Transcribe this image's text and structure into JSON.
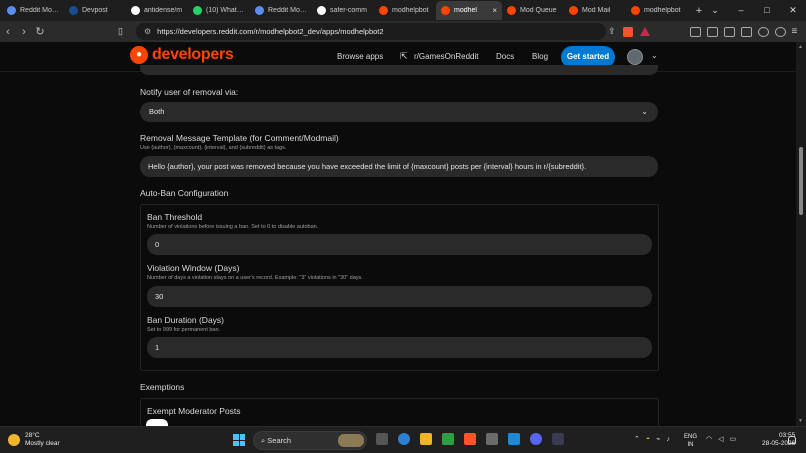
{
  "browser": {
    "tabs": [
      {
        "label": "Reddit Mod T",
        "color": "#5b8def",
        "active": false
      },
      {
        "label": "Devpost",
        "color": "#1a4d8f",
        "active": false
      },
      {
        "label": "antidense/m",
        "color": "#ffffff",
        "active": false
      },
      {
        "label": "(10) WhatsAp",
        "color": "#25d366",
        "active": false
      },
      {
        "label": "Reddit Mod T",
        "color": "#5b8def",
        "active": false
      },
      {
        "label": "safer-comm",
        "color": "#ffffff",
        "active": false
      },
      {
        "label": "modhelpbot",
        "color": "#ff4500",
        "active": false
      },
      {
        "label": "modhel",
        "color": "#ff4500",
        "active": true
      },
      {
        "label": "Mod Queue",
        "color": "#ff4500",
        "active": false
      },
      {
        "label": "Mod Mail",
        "color": "#ff4500",
        "active": false
      },
      {
        "label": "modhelpbot",
        "color": "#ff4500",
        "active": false
      }
    ],
    "new_tab": "+",
    "tab_close": "×",
    "window_controls": [
      "⌄",
      "–",
      "□",
      "✕"
    ],
    "url": "https://developers.reddit.com/r/modhelpbot2_dev/apps/modhelpbot2",
    "brave_count": "8"
  },
  "site": {
    "logo_text": "developers",
    "nav": {
      "browse": "Browse apps",
      "subreddit": "r/GamesOnReddit",
      "docs": "Docs",
      "blog": "Blog",
      "cta": "Get started"
    }
  },
  "form": {
    "notify_label": "Notify user of removal via:",
    "notify_value": "Both",
    "template_label": "Removal Message Template (for Comment/Modmail)",
    "template_help": "Use {author}, {maxcount}, {interval}, and {subreddit} as tags.",
    "template_value": "Hello {author}, your post was removed because you have exceeded the limit of {maxcount} posts per {interval} hours in r/{subreddit}.",
    "autoban_title": "Auto-Ban Configuration",
    "ban_threshold_label": "Ban Threshold",
    "ban_threshold_help": "Number of violations before issuing a ban. Set to 0 to disable autoban.",
    "ban_threshold_value": "0",
    "violation_window_label": "Violation Window (Days)",
    "violation_window_help": "Number of days a violation stays on a user's record. Example: \"3\" violations in \"30\" days.",
    "violation_window_value": "30",
    "ban_duration_label": "Ban Duration (Days)",
    "ban_duration_help": "Set to 999 for permanent ban.",
    "ban_duration_value": "1",
    "exemptions_title": "Exemptions",
    "exempt_mod_label": "Exempt Moderator Posts"
  },
  "taskbar": {
    "temp": "28°C",
    "weather": "Mostly clear",
    "search": "Search",
    "lang1": "ENG",
    "lang2": "IN",
    "time": "03:55",
    "date": "28-05-2026"
  },
  "colors": {
    "accent": "#ff4500",
    "cta": "#0079d3"
  }
}
